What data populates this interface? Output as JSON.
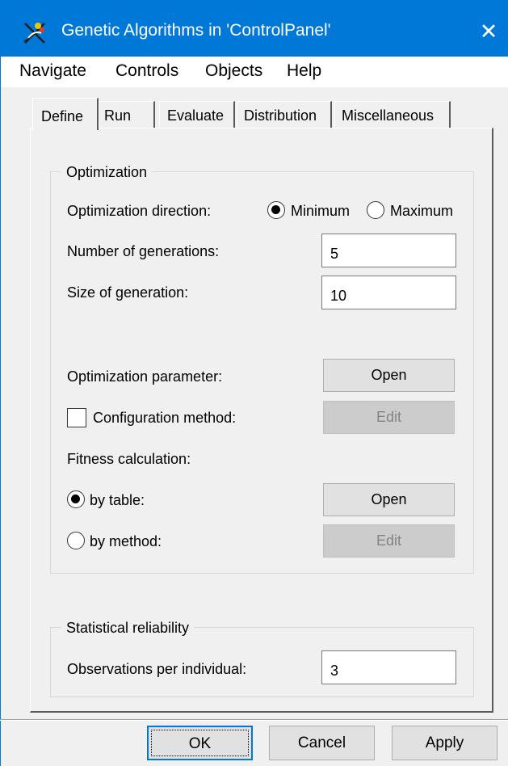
{
  "window": {
    "title": "Genetic Algorithms in 'ControlPanel'",
    "accent_color": "#0078d7",
    "close_glyph": "✕"
  },
  "menu": [
    "Navigate",
    "Controls",
    "Objects",
    "Help"
  ],
  "tabs": [
    {
      "label": "Define",
      "active": true
    },
    {
      "label": "Run"
    },
    {
      "label": "Evaluate"
    },
    {
      "label": "Distribution"
    },
    {
      "label": "Miscellaneous"
    }
  ],
  "optimization": {
    "legend": "Optimization",
    "direction_label": "Optimization direction:",
    "minimum_label": "Minimum",
    "maximum_label": "Maximum",
    "direction_selected": "Minimum",
    "generations_label": "Number of generations:",
    "generations_value": "5",
    "size_label": "Size of generation:",
    "size_value": "10",
    "param_label": "Optimization parameter:",
    "param_button": "Open",
    "config_label": "Configuration method:",
    "config_checked": false,
    "config_button": "Edit",
    "fitness_label": "Fitness calculation:",
    "by_table_label": "by table:",
    "by_table_button": "Open",
    "by_method_label": "by method:",
    "by_method_button": "Edit",
    "fitness_selected": "by table"
  },
  "statistical": {
    "legend": "Statistical reliability",
    "observations_label": "Observations per individual:",
    "observations_value": "3"
  },
  "footer": {
    "ok": "OK",
    "cancel": "Cancel",
    "apply": "Apply"
  }
}
